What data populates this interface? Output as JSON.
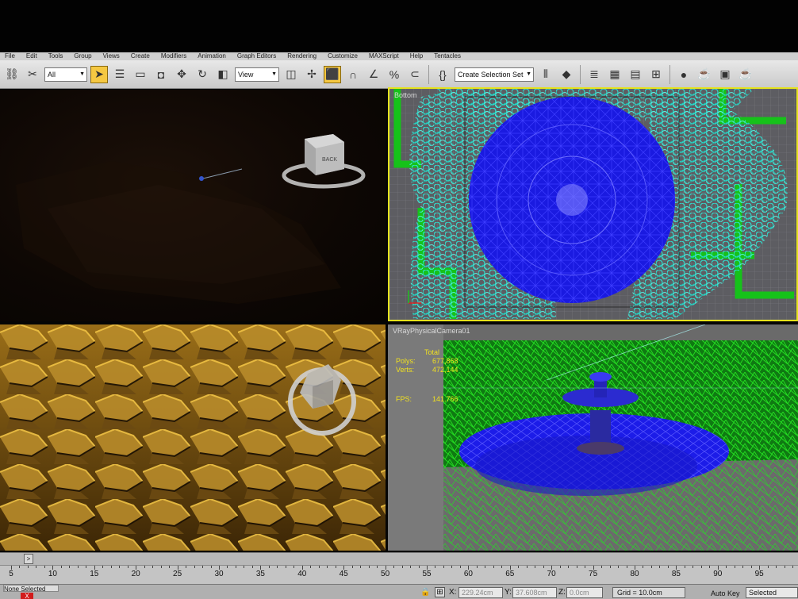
{
  "menubar": {
    "items": [
      "File",
      "Edit",
      "Tools",
      "Group",
      "Views",
      "Create",
      "Modifiers",
      "Animation",
      "Graph Editors",
      "Rendering",
      "Customize",
      "MAXScript",
      "Help",
      "Tentacles"
    ]
  },
  "toolbar": {
    "filter_value": "All",
    "reference_coord": "View",
    "named_selection": "Create Selection Set"
  },
  "viewports": {
    "top_left": {
      "label": "",
      "viewcube_face": "BACK"
    },
    "top_right": {
      "label": "Bottom"
    },
    "bottom_left": {
      "label": ""
    },
    "bottom_right": {
      "label": "VRayPhysicalCamera01",
      "stats_header": "Total",
      "stats": [
        {
          "key": "Polys:",
          "value": "677,868"
        },
        {
          "key": "Verts:",
          "value": "472,144"
        },
        {
          "key": "FPS:",
          "value": "141.766"
        }
      ]
    }
  },
  "timeline": {
    "slider_label": ">",
    "ruler_numbers": [
      "5",
      "10",
      "15",
      "20",
      "25",
      "30",
      "35",
      "40",
      "45",
      "50",
      "55",
      "60",
      "65",
      "70",
      "75",
      "80",
      "85",
      "90",
      "95"
    ]
  },
  "status": {
    "selection_text": "None Selected",
    "close_label": "X",
    "x_label": "X:",
    "x_value": "229.24cm",
    "y_label": "Y:",
    "y_value": "37.608cm",
    "z_label": "Z:",
    "z_value": "0.0cm",
    "grid": "Grid = 10.0cm",
    "auto_key": "Auto Key",
    "key_mode": "Selected"
  },
  "colors": {
    "active_viewport_border": "#e5e21c",
    "foliage_wire": "#2fe0d0",
    "water_wire": "#1a1ae0",
    "grass_wire": "#18d010",
    "stats_text": "#f0e020"
  }
}
